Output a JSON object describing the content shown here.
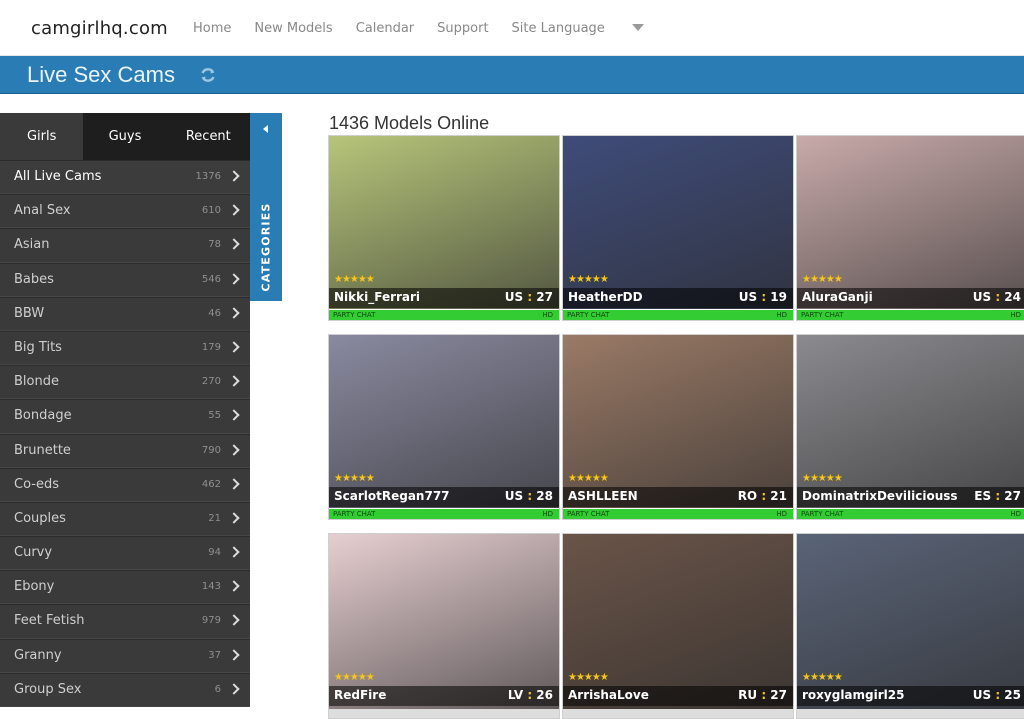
{
  "site": {
    "logo": "camgirlhq.com",
    "nav": [
      "Home",
      "New Models",
      "Calendar",
      "Support",
      "Site Language"
    ]
  },
  "banner": {
    "title": "Live Sex Cams"
  },
  "sidebar": {
    "tabs": [
      "Girls",
      "Guys",
      "Recent"
    ],
    "categories_tab_label": "CATEGORIES",
    "items": [
      {
        "label": "All Live Cams",
        "count": "1376"
      },
      {
        "label": "Anal Sex",
        "count": "610"
      },
      {
        "label": "Asian",
        "count": "78"
      },
      {
        "label": "Babes",
        "count": "546"
      },
      {
        "label": "BBW",
        "count": "46"
      },
      {
        "label": "Big Tits",
        "count": "179"
      },
      {
        "label": "Blonde",
        "count": "270"
      },
      {
        "label": "Bondage",
        "count": "55"
      },
      {
        "label": "Brunette",
        "count": "790"
      },
      {
        "label": "Co-eds",
        "count": "462"
      },
      {
        "label": "Couples",
        "count": "21"
      },
      {
        "label": "Curvy",
        "count": "94"
      },
      {
        "label": "Ebony",
        "count": "143"
      },
      {
        "label": "Feet Fetish",
        "count": "979"
      },
      {
        "label": "Granny",
        "count": "37"
      },
      {
        "label": "Group Sex",
        "count": "6"
      }
    ]
  },
  "main": {
    "heading": "1436 Models Online",
    "models": [
      {
        "name": "Nikki_Ferrari",
        "country": "US",
        "age": "27",
        "status": "PARTY CHAT",
        "quality": "HD",
        "stars": "★★★★★",
        "bg": "#b7c57a"
      },
      {
        "name": "HeatherDD",
        "country": "US",
        "age": "19",
        "status": "PARTY CHAT",
        "quality": "HD",
        "stars": "★★★★★",
        "bg": "#3f4c7a"
      },
      {
        "name": "AluraGanji",
        "country": "US",
        "age": "24",
        "status": "PARTY CHAT",
        "quality": "HD",
        "stars": "★★★★★",
        "bg": "#c8aaa9"
      },
      {
        "name": "ScarlotRegan777",
        "country": "US",
        "age": "28",
        "status": "PARTY CHAT",
        "quality": "HD",
        "stars": "★★★★★",
        "bg": "#8a8aa0"
      },
      {
        "name": "ASHLLEEN",
        "country": "RO",
        "age": "21",
        "status": "PARTY CHAT",
        "quality": "HD",
        "stars": "★★★★★",
        "bg": "#9a7a66"
      },
      {
        "name": "DominatrixDeviliciouss",
        "country": "ES",
        "age": "27",
        "status": "PARTY CHAT",
        "quality": "HD",
        "stars": "★★★★★",
        "bg": "#8b8a8e"
      },
      {
        "name": "RedFire",
        "country": "LV",
        "age": "26",
        "status": "",
        "quality": "",
        "stars": "★★★★★",
        "bg": "#e7cfd1"
      },
      {
        "name": "ArrishaLove",
        "country": "RU",
        "age": "27",
        "status": "",
        "quality": "",
        "stars": "★★★★★",
        "bg": "#6a5448"
      },
      {
        "name": "roxyglamgirl25",
        "country": "US",
        "age": "25",
        "status": "",
        "quality": "",
        "stars": "★★★★★",
        "bg": "#5a6478"
      }
    ]
  }
}
